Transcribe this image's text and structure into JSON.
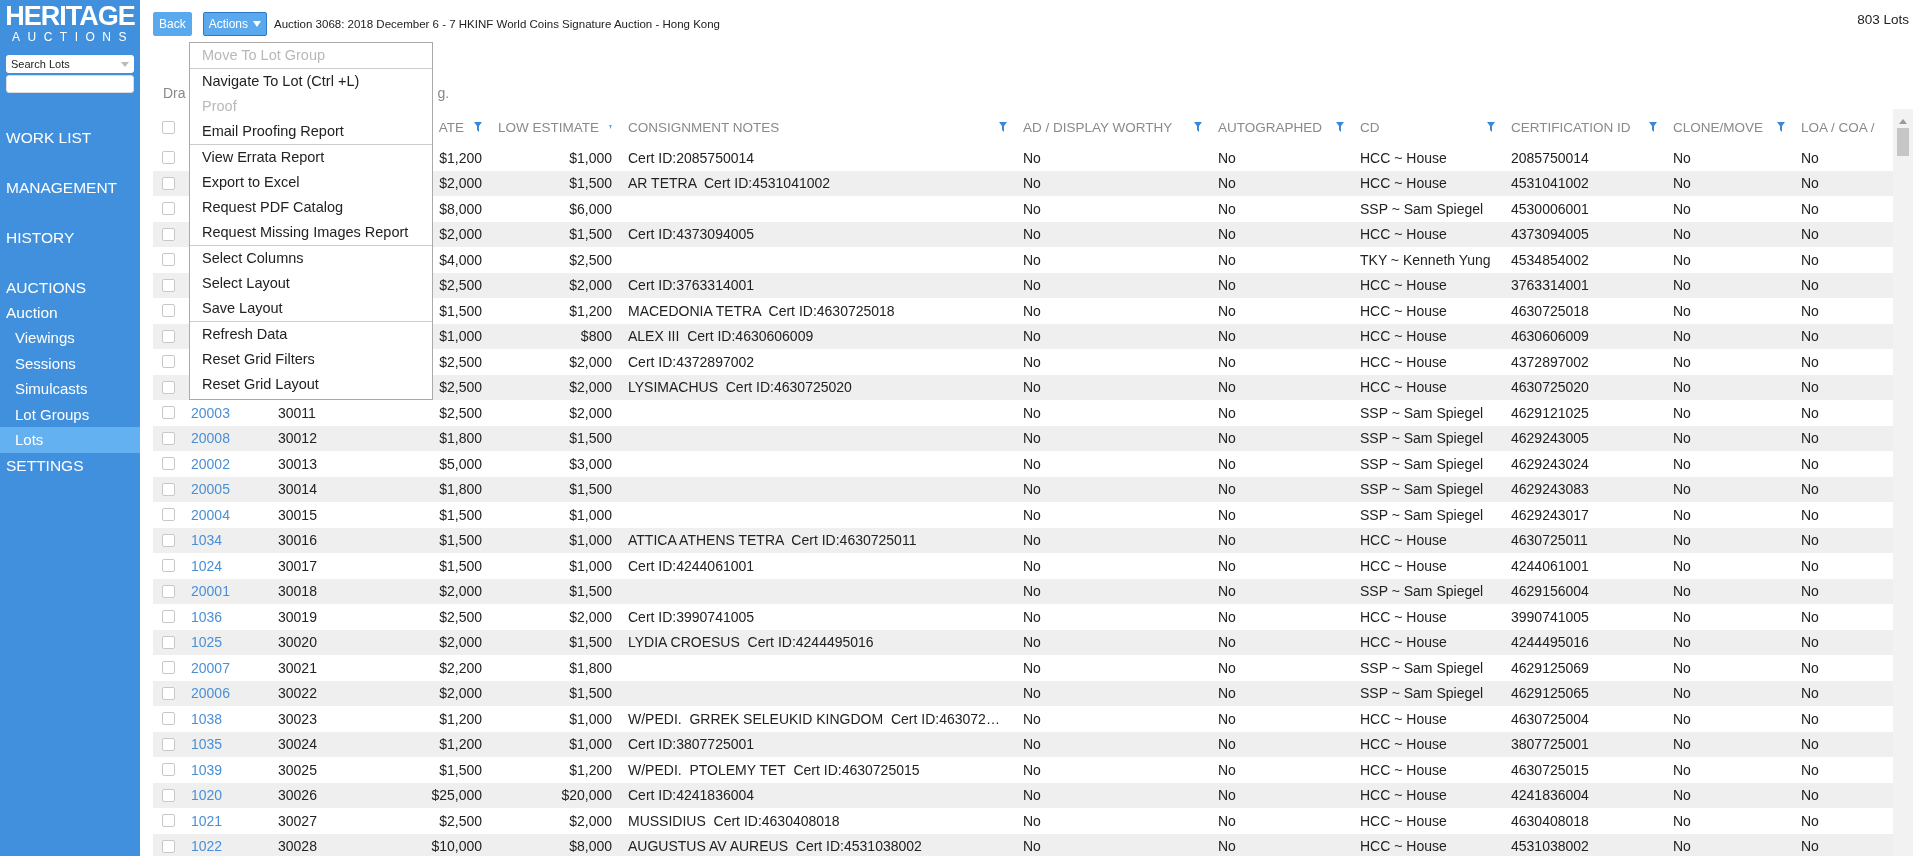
{
  "logo": {
    "name": "HERITAGE",
    "tagline": "AUCTIONS"
  },
  "search": {
    "scope": "Search Lots"
  },
  "sidebar": [
    {
      "label": "WORK LIST",
      "selected": false
    },
    {
      "label": "MANAGEMENT",
      "selected": false
    },
    {
      "label": "HISTORY",
      "selected": false
    },
    {
      "label": "AUCTIONS",
      "selected": false,
      "children": [
        {
          "label": "Auction",
          "selected": false,
          "children": [
            {
              "label": "Viewings",
              "selected": false
            },
            {
              "label": "Sessions",
              "selected": false
            },
            {
              "label": "Simulcasts",
              "selected": false
            },
            {
              "label": "Lot Groups",
              "selected": false
            },
            {
              "label": "Lots",
              "selected": true
            }
          ]
        }
      ]
    },
    {
      "label": "SETTINGS",
      "selected": false
    }
  ],
  "toolbar": {
    "back": "Back",
    "actions": "Actions",
    "title": "Auction 3068: 2018 December 6 - 7 HKINF World Coins Signature Auction - Hong Kong",
    "count": "803 Lots"
  },
  "group_hint": [
    "Dra",
    "g."
  ],
  "menu": [
    [
      {
        "label": "Move To Lot Group",
        "disabled": true
      }
    ],
    [
      {
        "label": "Navigate To Lot (Ctrl +L)",
        "disabled": false
      },
      {
        "label": "Proof",
        "disabled": true
      },
      {
        "label": "Email Proofing Report",
        "disabled": false
      }
    ],
    [
      {
        "label": "View Errata Report",
        "disabled": false
      },
      {
        "label": "Export to Excel",
        "disabled": false
      },
      {
        "label": "Request PDF Catalog",
        "disabled": false
      },
      {
        "label": "Request Missing Images Report",
        "disabled": false
      }
    ],
    [
      {
        "label": "Select Columns",
        "disabled": false
      },
      {
        "label": "Select Layout",
        "disabled": false
      },
      {
        "label": "Save Layout",
        "disabled": false
      }
    ],
    [
      {
        "label": "Refresh Data",
        "disabled": false
      },
      {
        "label": "Reset Grid Filters",
        "disabled": false
      },
      {
        "label": "Reset Grid Layout",
        "disabled": false
      }
    ]
  ],
  "table": {
    "select_all": {
      "checked": false
    },
    "columns": [
      {
        "label": "ATE",
        "filter": true
      },
      {
        "label": "LOW ESTIMATE",
        "filter": true
      },
      {
        "label": "CONSIGNMENT NOTES",
        "filter": true
      },
      {
        "label": "AD / DISPLAY WORTHY",
        "filter": true
      },
      {
        "label": "AUTOGRAPHED",
        "filter": true
      },
      {
        "label": "CD",
        "filter": true
      },
      {
        "label": "CERTIFICATION ID",
        "filter": true
      },
      {
        "label": "CLONE/MOVE",
        "filter": true
      },
      {
        "label": "LOA / COA /",
        "filter": false
      }
    ],
    "rows": [
      {
        "checked": false,
        "high": "$1,200",
        "low": "$1,000",
        "notes": "Cert ID:2085750014",
        "ad": "No",
        "autographed": "No",
        "cd": "HCC ~ House",
        "cert": "2085750014",
        "clone": "No",
        "loa": "No"
      },
      {
        "checked": false,
        "high": "$2,000",
        "low": "$1,500",
        "notes": "AR TETRA  Cert ID:4531041002",
        "ad": "No",
        "autographed": "No",
        "cd": "HCC ~ House",
        "cert": "4531041002",
        "clone": "No",
        "loa": "No"
      },
      {
        "checked": false,
        "high": "$8,000",
        "low": "$6,000",
        "ad": "No",
        "autographed": "No",
        "cd": "SSP ~ Sam Spiegel",
        "cert": "4530006001",
        "clone": "No",
        "loa": "No"
      },
      {
        "checked": false,
        "high": "$2,000",
        "low": "$1,500",
        "notes": "Cert ID:4373094005",
        "ad": "No",
        "autographed": "No",
        "cd": "HCC ~ House",
        "cert": "4373094005",
        "clone": "No",
        "loa": "No"
      },
      {
        "checked": false,
        "high": "$4,000",
        "low": "$2,500",
        "ad": "No",
        "autographed": "No",
        "cd": "TKY ~ Kenneth Yung",
        "cert": "4534854002",
        "clone": "No",
        "loa": "No"
      },
      {
        "checked": false,
        "high": "$2,500",
        "low": "$2,000",
        "notes": "Cert ID:3763314001",
        "ad": "No",
        "autographed": "No",
        "cd": "HCC ~ House",
        "cert": "3763314001",
        "clone": "No",
        "loa": "No"
      },
      {
        "checked": false,
        "high": "$1,500",
        "low": "$1,200",
        "notes": "MACEDONIA TETRA  Cert ID:4630725018",
        "ad": "No",
        "autographed": "No",
        "cd": "HCC ~ House",
        "cert": "4630725018",
        "clone": "No",
        "loa": "No"
      },
      {
        "checked": false,
        "high": "$1,000",
        "low": "$800",
        "notes": "ALEX III  Cert ID:4630606009",
        "ad": "No",
        "autographed": "No",
        "cd": "HCC ~ House",
        "cert": "4630606009",
        "clone": "No",
        "loa": "No"
      },
      {
        "checked": false,
        "high": "$2,500",
        "low": "$2,000",
        "notes": "Cert ID:4372897002",
        "ad": "No",
        "autographed": "No",
        "cd": "HCC ~ House",
        "cert": "4372897002",
        "clone": "No",
        "loa": "No"
      },
      {
        "checked": false,
        "high": "$2,500",
        "low": "$2,000",
        "notes": "LYSIMACHUS  Cert ID:4630725020",
        "ad": "No",
        "autographed": "No",
        "cd": "HCC ~ House",
        "cert": "4630725020",
        "clone": "No",
        "loa": "No"
      },
      {
        "checked": false,
        "lot": "20003",
        "number": "30011",
        "high": "$2,500",
        "low": "$2,000",
        "ad": "No",
        "autographed": "No",
        "cd": "SSP ~ Sam Spiegel",
        "cert": "4629121025",
        "clone": "No",
        "loa": "No"
      },
      {
        "checked": false,
        "lot": "20008",
        "number": "30012",
        "high": "$1,800",
        "low": "$1,500",
        "ad": "No",
        "autographed": "No",
        "cd": "SSP ~ Sam Spiegel",
        "cert": "4629243005",
        "clone": "No",
        "loa": "No"
      },
      {
        "checked": false,
        "lot": "20002",
        "number": "30013",
        "high": "$5,000",
        "low": "$3,000",
        "ad": "No",
        "autographed": "No",
        "cd": "SSP ~ Sam Spiegel",
        "cert": "4629243024",
        "clone": "No",
        "loa": "No"
      },
      {
        "checked": false,
        "lot": "20005",
        "number": "30014",
        "high": "$1,800",
        "low": "$1,500",
        "ad": "No",
        "autographed": "No",
        "cd": "SSP ~ Sam Spiegel",
        "cert": "4629243083",
        "clone": "No",
        "loa": "No"
      },
      {
        "checked": false,
        "lot": "20004",
        "number": "30015",
        "high": "$1,500",
        "low": "$1,000",
        "ad": "No",
        "autographed": "No",
        "cd": "SSP ~ Sam Spiegel",
        "cert": "4629243017",
        "clone": "No",
        "loa": "No"
      },
      {
        "checked": false,
        "lot": "1034",
        "number": "30016",
        "high": "$1,500",
        "low": "$1,000",
        "notes": "ATTICA ATHENS TETRA  Cert ID:4630725011",
        "ad": "No",
        "autographed": "No",
        "cd": "HCC ~ House",
        "cert": "4630725011",
        "clone": "No",
        "loa": "No"
      },
      {
        "checked": false,
        "lot": "1024",
        "number": "30017",
        "high": "$1,500",
        "low": "$1,000",
        "notes": "Cert ID:4244061001",
        "ad": "No",
        "autographed": "No",
        "cd": "HCC ~ House",
        "cert": "4244061001",
        "clone": "No",
        "loa": "No"
      },
      {
        "checked": false,
        "lot": "20001",
        "number": "30018",
        "high": "$2,000",
        "low": "$1,500",
        "ad": "No",
        "autographed": "No",
        "cd": "SSP ~ Sam Spiegel",
        "cert": "4629156004",
        "clone": "No",
        "loa": "No"
      },
      {
        "checked": false,
        "lot": "1036",
        "number": "30019",
        "high": "$2,500",
        "low": "$2,000",
        "notes": "Cert ID:3990741005",
        "ad": "No",
        "autographed": "No",
        "cd": "HCC ~ House",
        "cert": "3990741005",
        "clone": "No",
        "loa": "No"
      },
      {
        "checked": false,
        "lot": "1025",
        "number": "30020",
        "high": "$2,000",
        "low": "$1,500",
        "notes": "LYDIA CROESUS  Cert ID:4244495016",
        "ad": "No",
        "autographed": "No",
        "cd": "HCC ~ House",
        "cert": "4244495016",
        "clone": "No",
        "loa": "No"
      },
      {
        "checked": false,
        "lot": "20007",
        "number": "30021",
        "high": "$2,200",
        "low": "$1,800",
        "ad": "No",
        "autographed": "No",
        "cd": "SSP ~ Sam Spiegel",
        "cert": "4629125069",
        "clone": "No",
        "loa": "No"
      },
      {
        "checked": false,
        "lot": "20006",
        "number": "30022",
        "high": "$2,000",
        "low": "$1,500",
        "ad": "No",
        "autographed": "No",
        "cd": "SSP ~ Sam Spiegel",
        "cert": "4629125065",
        "clone": "No",
        "loa": "No"
      },
      {
        "checked": false,
        "lot": "1038",
        "number": "30023",
        "high": "$1,200",
        "low": "$1,000",
        "notes": "W/PEDI.  GRREK SELEUKID KINGDOM  Cert ID:463072…",
        "ad": "No",
        "autographed": "No",
        "cd": "HCC ~ House",
        "cert": "4630725004",
        "clone": "No",
        "loa": "No"
      },
      {
        "checked": false,
        "lot": "1035",
        "number": "30024",
        "high": "$1,200",
        "low": "$1,000",
        "notes": "Cert ID:3807725001",
        "ad": "No",
        "autographed": "No",
        "cd": "HCC ~ House",
        "cert": "3807725001",
        "clone": "No",
        "loa": "No"
      },
      {
        "checked": false,
        "lot": "1039",
        "number": "30025",
        "high": "$1,500",
        "low": "$1,200",
        "notes": "W/PEDI.  PTOLEMY TET  Cert ID:4630725015",
        "ad": "No",
        "autographed": "No",
        "cd": "HCC ~ House",
        "cert": "4630725015",
        "clone": "No",
        "loa": "No"
      },
      {
        "checked": false,
        "lot": "1020",
        "number": "30026",
        "high": "$25,000",
        "low": "$20,000",
        "notes": "Cert ID:4241836004",
        "ad": "No",
        "autographed": "No",
        "cd": "HCC ~ House",
        "cert": "4241836004",
        "clone": "No",
        "loa": "No"
      },
      {
        "checked": false,
        "lot": "1021",
        "number": "30027",
        "high": "$2,500",
        "low": "$2,000",
        "notes": "MUSSIDIUS  Cert ID:4630408018",
        "ad": "No",
        "autographed": "No",
        "cd": "HCC ~ House",
        "cert": "4630408018",
        "clone": "No",
        "loa": "No"
      },
      {
        "checked": false,
        "lot": "1022",
        "number": "30028",
        "high": "$10,000",
        "low": "$8,000",
        "notes": "AUGUSTUS AV AUREUS  Cert ID:4531038002",
        "ad": "No",
        "autographed": "No",
        "cd": "HCC ~ House",
        "cert": "4531038002",
        "clone": "No",
        "loa": "No"
      }
    ]
  }
}
